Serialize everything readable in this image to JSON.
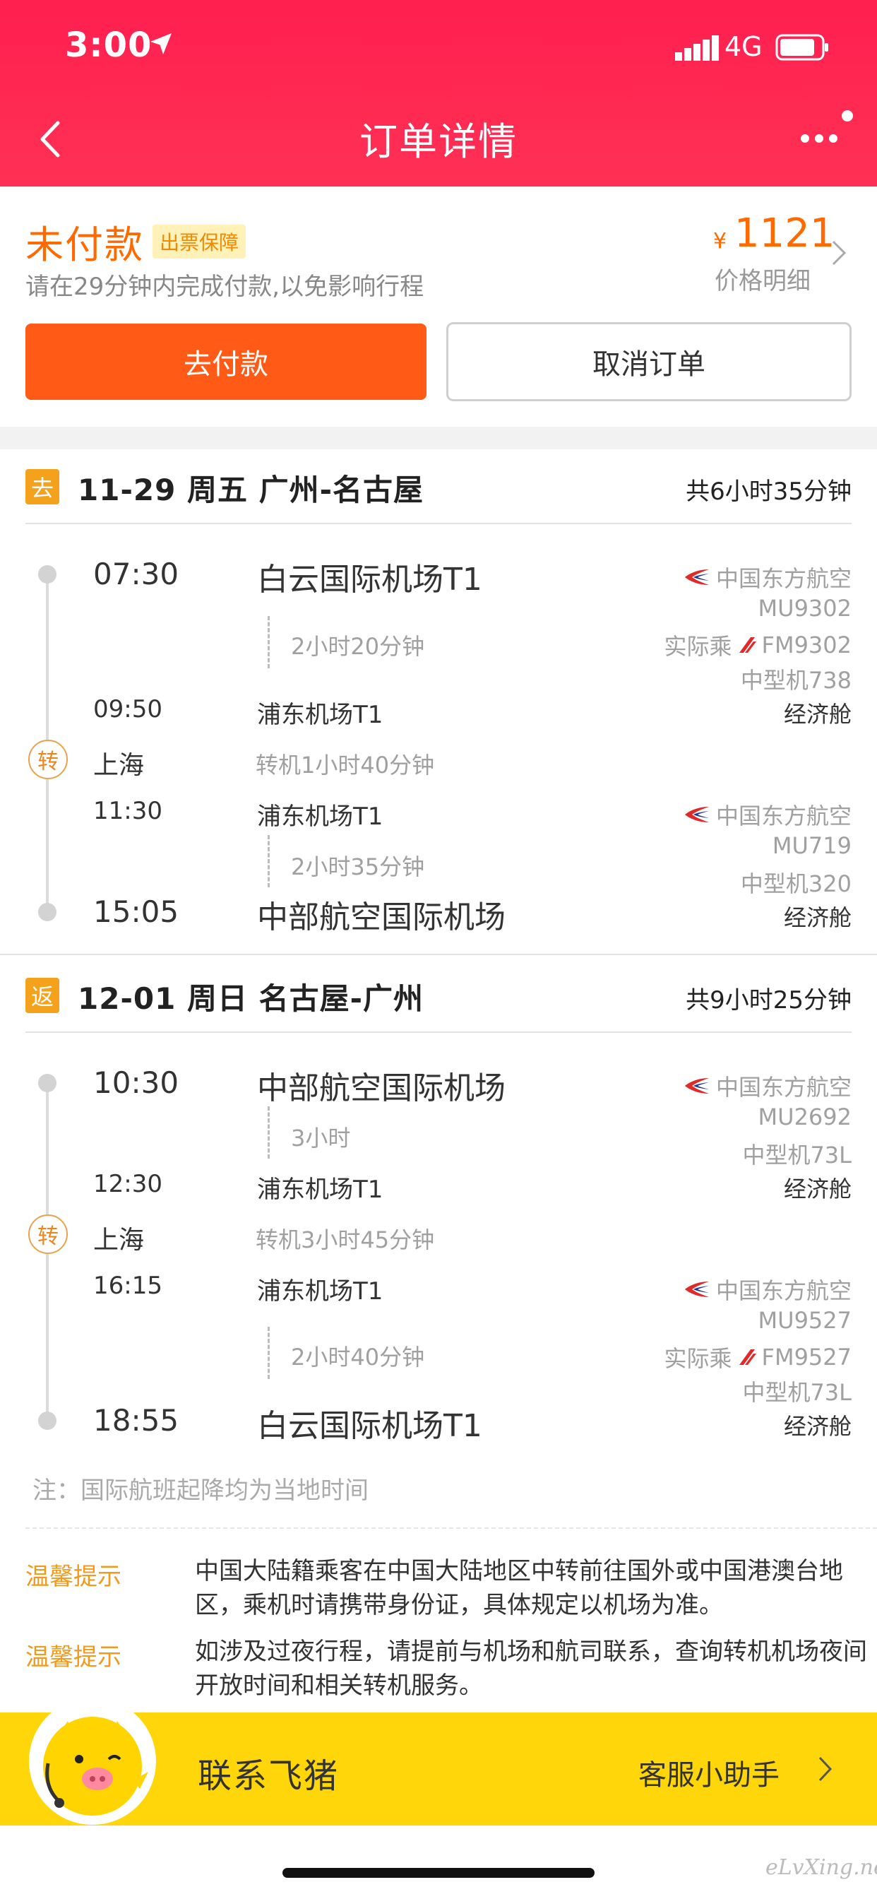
{
  "status_bar": {
    "time": "3:00",
    "network": "4G"
  },
  "nav": {
    "title": "订单详情"
  },
  "order": {
    "status": "未付款",
    "badge": "出票保障",
    "notice": "请在29分钟内完成付款,以免影响行程",
    "currency": "¥",
    "price": "1121",
    "price_detail": "价格明细",
    "pay_label": "去付款",
    "cancel_label": "取消订单"
  },
  "outbound": {
    "tag": "去",
    "title": "11-29 周五 广州-名古屋",
    "total": "共6小时35分钟",
    "seg1": {
      "dep_time": "07:30",
      "dep_airport": "白云国际机场T1",
      "duration": "2小时20分钟",
      "arr_time": "09:50",
      "arr_airport": "浦东机场T1",
      "airline": "中国东方航空",
      "flight": "MU9302",
      "actual_label": "实际乘",
      "actual_flight": "FM9302",
      "aircraft": "中型机738",
      "cabin": "经济舱"
    },
    "transfer": {
      "icon_text": "转",
      "city": "上海",
      "text": "转机1小时40分钟"
    },
    "seg2": {
      "dep_time": "11:30",
      "dep_airport": "浦东机场T1",
      "duration": "2小时35分钟",
      "arr_time": "15:05",
      "arr_airport": "中部航空国际机场",
      "airline": "中国东方航空",
      "flight": "MU719",
      "aircraft": "中型机320",
      "cabin": "经济舱"
    }
  },
  "return": {
    "tag": "返",
    "title": "12-01 周日 名古屋-广州",
    "total": "共9小时25分钟",
    "seg1": {
      "dep_time": "10:30",
      "dep_airport": "中部航空国际机场",
      "duration": "3小时",
      "arr_time": "12:30",
      "arr_airport": "浦东机场T1",
      "airline": "中国东方航空",
      "flight": "MU2692",
      "aircraft": "中型机73L",
      "cabin": "经济舱"
    },
    "transfer": {
      "icon_text": "转",
      "city": "上海",
      "text": "转机3小时45分钟"
    },
    "seg2": {
      "dep_time": "16:15",
      "dep_airport": "浦东机场T1",
      "duration": "2小时40分钟",
      "arr_time": "18:55",
      "arr_airport": "白云国际机场T1",
      "airline": "中国东方航空",
      "flight": "MU9527",
      "actual_label": "实际乘",
      "actual_flight": "FM9527",
      "aircraft": "中型机73L",
      "cabin": "经济舱"
    }
  },
  "footnote": "注：国际航班起降均为当地时间",
  "tips": [
    {
      "label": "温馨提示",
      "text": "中国大陆籍乘客在中国大陆地区中转前往国外或中国港澳台地区，乘机时请携带身份证，具体规定以机场为准。"
    },
    {
      "label": "温馨提示",
      "text": "如涉及过夜行程，请提前与机场和航司联系，查询转机机场夜间开放时间和相关转机服务。"
    }
  ],
  "contact": {
    "label": "联系飞猪",
    "service": "客服小助手"
  },
  "watermark": "eLvXing.net",
  "colors": {
    "header": "#ff2450",
    "accent": "#ff6a00",
    "pay": "#ff5a16",
    "tag": "#f4a11c",
    "contact_bar": "#ffd60a"
  }
}
